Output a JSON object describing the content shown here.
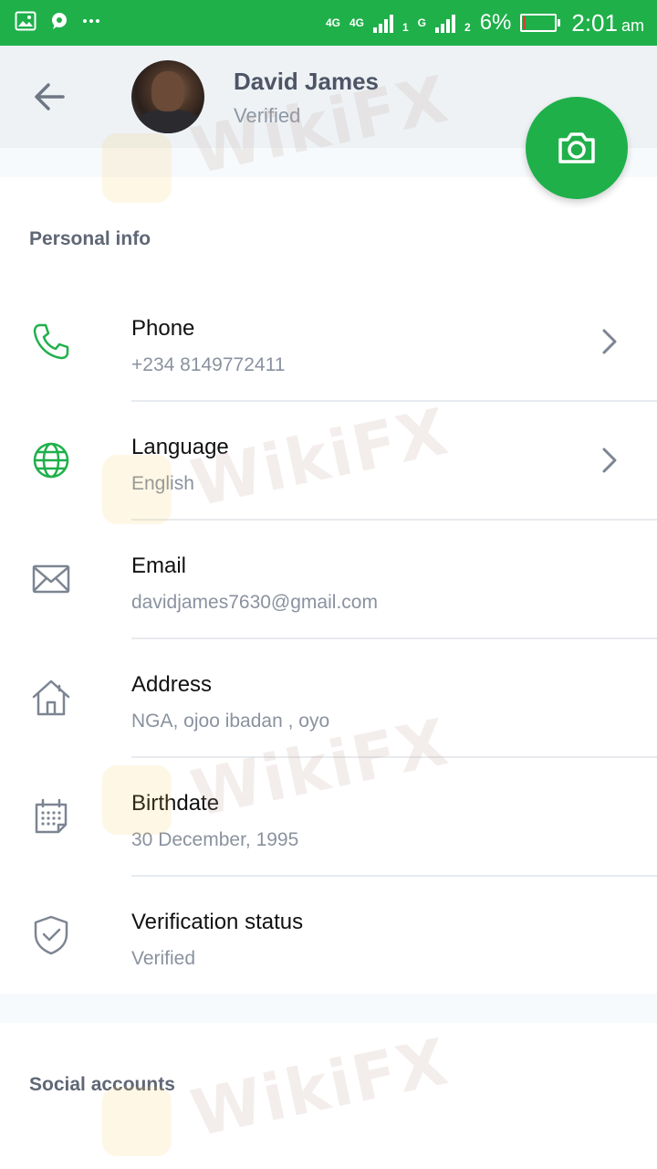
{
  "status_bar": {
    "network_left": "4G",
    "network_right": "4G",
    "sim1": "1",
    "sim2_type": "G",
    "sim2": "2",
    "battery_percent": "6%",
    "battery_level": 0.06,
    "time": "2:01",
    "ampm": "am"
  },
  "header": {
    "name": "David James",
    "status": "Verified"
  },
  "sections": {
    "personal_info": "Personal info",
    "social_accounts": "Social accounts"
  },
  "rows": [
    {
      "label": "Phone",
      "value": "+234 8149772411",
      "icon": "phone-icon",
      "chevron": true
    },
    {
      "label": "Language",
      "value": "English",
      "icon": "globe-icon",
      "chevron": true
    },
    {
      "label": "Email",
      "value": "davidjames7630@gmail.com",
      "icon": "envelope-icon",
      "chevron": false
    },
    {
      "label": "Address",
      "value": "NGA, ojoo ibadan , oyo",
      "icon": "home-icon",
      "chevron": false
    },
    {
      "label": "Birthdate",
      "value": "30 December, 1995",
      "icon": "calendar-icon",
      "chevron": false
    },
    {
      "label": "Verification status",
      "value": "Verified",
      "icon": "shield-check-icon",
      "chevron": false
    }
  ],
  "watermark_text": "WikiFX",
  "colors": {
    "accent": "#1fb04a",
    "icon_gray": "#7d8592",
    "text_secondary": "#8a929f"
  }
}
